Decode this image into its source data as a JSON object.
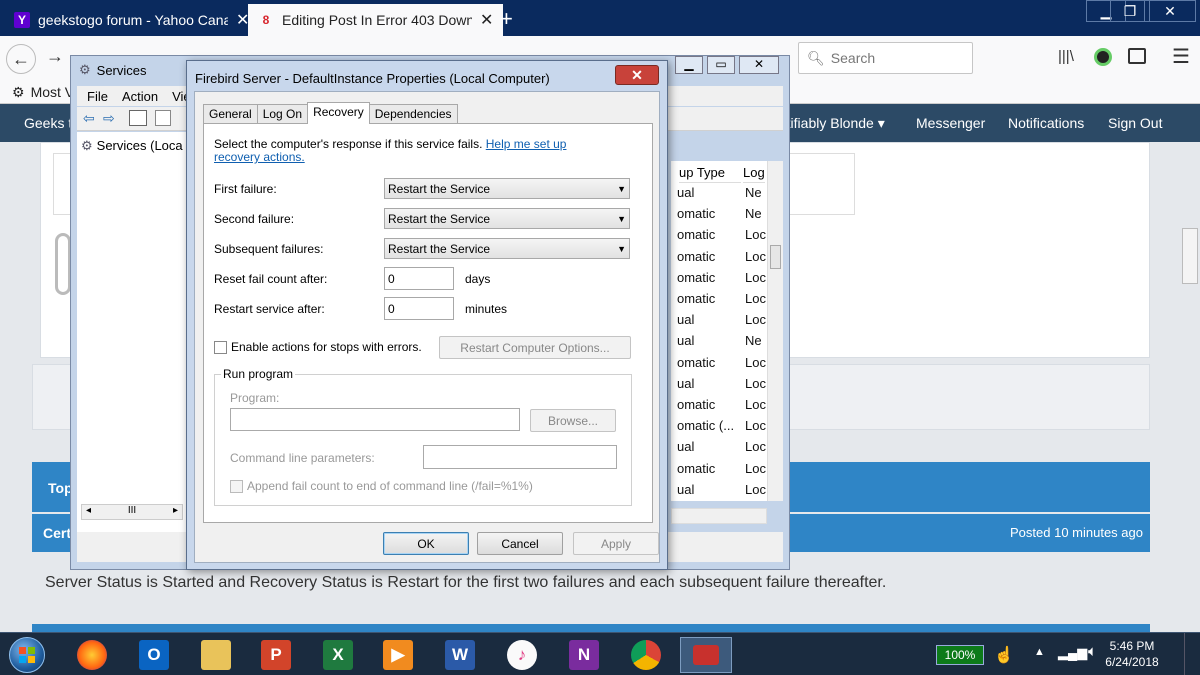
{
  "browser": {
    "tabs": [
      {
        "title": "geekstogo forum - Yahoo Cana",
        "favicon": "Y"
      },
      {
        "title": "Editing Post In Error 403 Downl",
        "favicon": "8"
      }
    ],
    "search_placeholder": "Search",
    "bookmark_label": "Most V"
  },
  "forum": {
    "nav_left": "Geeks t",
    "nav_items": [
      "rtifiably Blonde ▾",
      "Messenger",
      "Notifications",
      "Sign Out"
    ],
    "bar_top_label": "Top",
    "post_header_label": "Cert",
    "posted": "Posted 10 minutes ago",
    "body_text": "Server Status is Started and Recovery Status is Restart for the first two failures and each subsequent failure thereafter."
  },
  "services": {
    "title": "Services",
    "menu": [
      "File",
      "Action",
      "Vie"
    ],
    "tree_item": "Services (Loca",
    "columns": [
      "up Type",
      "Log"
    ],
    "rows": [
      [
        "ual",
        "Ne"
      ],
      [
        "omatic",
        "Ne"
      ],
      [
        "omatic",
        "Loc"
      ],
      [
        "omatic",
        "Loc"
      ],
      [
        "omatic",
        "Loc"
      ],
      [
        "omatic",
        "Loc"
      ],
      [
        "ual",
        "Loc"
      ],
      [
        "ual",
        "Ne"
      ],
      [
        "omatic",
        "Loc"
      ],
      [
        "ual",
        "Loc"
      ],
      [
        "omatic",
        "Loc"
      ],
      [
        "omatic (...",
        "Loc"
      ],
      [
        "ual",
        "Loc"
      ],
      [
        "omatic",
        "Loc"
      ],
      [
        "ual",
        "Loc"
      ]
    ]
  },
  "dialog": {
    "title": "Firebird Server - DefaultInstance Properties (Local Computer)",
    "tabs": [
      "General",
      "Log On",
      "Recovery",
      "Dependencies"
    ],
    "active_tab": "Recovery",
    "intro": "Select the computer's response if this service fails.",
    "help_link": "Help me set up recovery actions.",
    "first_failure_label": "First failure:",
    "first_failure_value": "Restart the Service",
    "second_failure_label": "Second failure:",
    "second_failure_value": "Restart the Service",
    "subsequent_label": "Subsequent failures:",
    "subsequent_value": "Restart the Service",
    "reset_label": "Reset fail count after:",
    "reset_value": "0",
    "reset_unit": "days",
    "restart_label": "Restart service after:",
    "restart_value": "0",
    "restart_unit": "minutes",
    "enable_actions_label": "Enable actions for stops with errors.",
    "restart_options_btn": "Restart Computer Options...",
    "run_program_legend": "Run program",
    "program_label": "Program:",
    "browse_btn": "Browse...",
    "cmd_params_label": "Command line parameters:",
    "append_label": "Append fail count to end of command line (/fail=%1%)",
    "ok": "OK",
    "cancel": "Cancel",
    "apply": "Apply"
  },
  "taskbar": {
    "battery": "100%",
    "time": "5:46 PM",
    "date": "6/24/2018"
  }
}
